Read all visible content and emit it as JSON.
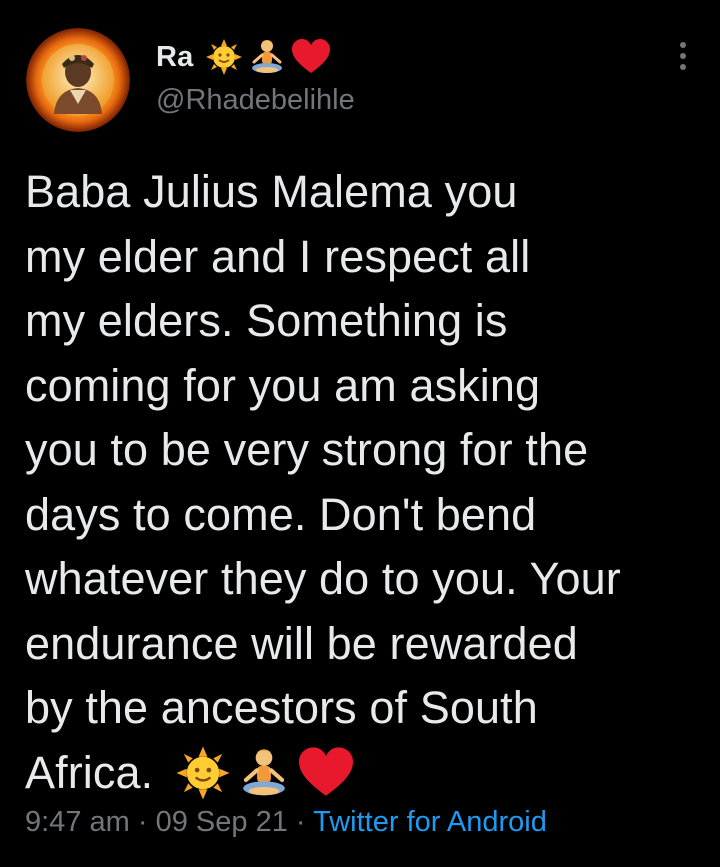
{
  "author": {
    "display_name": "Ra",
    "handle": "@Rhadebelihle",
    "name_emojis": [
      "sun-with-face-icon",
      "person-lotus-position-icon",
      "red-heart-icon"
    ]
  },
  "tweet": {
    "lines": [
      "Baba Julius Malema you",
      "my elder and I respect all",
      "my elders. Something is",
      "coming for you am asking",
      "you to be very strong for the",
      "days to come. Don't bend",
      "whatever they do to you. Your",
      "endurance will be rewarded",
      "by the ancestors of South",
      "Africa."
    ],
    "trailing_emojis": [
      "sun-with-face-icon",
      "person-lotus-position-icon",
      "red-heart-icon"
    ]
  },
  "meta": {
    "time": "9:47 am",
    "separator": "·",
    "date": "09 Sep 21",
    "source": "Twitter for Android"
  },
  "colors": {
    "background": "#000000",
    "text": "#e7e9ea",
    "secondary": "#71767b",
    "link": "#1d9bf0"
  }
}
